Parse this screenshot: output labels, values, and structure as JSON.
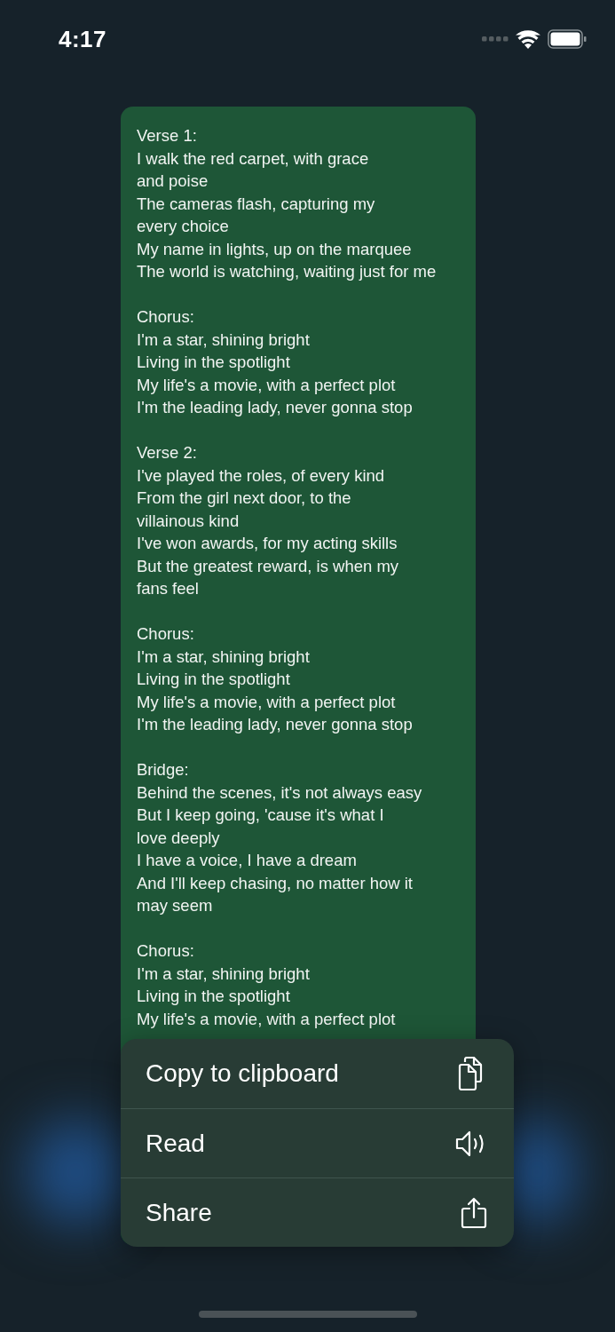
{
  "status_bar": {
    "time": "4:17"
  },
  "message": {
    "stanzas": [
      {
        "lines": [
          "Verse 1:",
          "I walk the red carpet, with grace",
          "and poise",
          "The cameras flash, capturing my",
          "every choice",
          "My name in lights, up on the marquee",
          "The world is watching, waiting just for me"
        ]
      },
      {
        "lines": [
          "Chorus:",
          "I'm a star, shining bright",
          "Living in the spotlight",
          "My life's a movie, with a perfect plot",
          "I'm the leading lady, never gonna stop"
        ]
      },
      {
        "lines": [
          "Verse 2:",
          "I've played the roles, of every kind",
          "From the girl next door, to the",
          "villainous kind",
          "I've won awards, for my acting skills",
          "But the greatest reward, is when my",
          "fans feel"
        ]
      },
      {
        "lines": [
          "Chorus:",
          "I'm a star, shining bright",
          "Living in the spotlight",
          "My life's a movie, with a perfect plot",
          "I'm the leading lady, never gonna stop"
        ]
      },
      {
        "lines": [
          "Bridge:",
          "Behind the scenes, it's not always easy",
          "But I keep going, 'cause it's what I",
          "love deeply",
          "I have a voice, I have a dream",
          "And I'll keep chasing, no matter how it",
          "may seem"
        ]
      },
      {
        "lines": [
          "Chorus:",
          "I'm a star, shining bright",
          "Living in the spotlight",
          "My life's a movie, with a perfect plot"
        ]
      }
    ]
  },
  "context_menu": [
    {
      "label": "Copy to clipboard",
      "kind": "copy"
    },
    {
      "label": "Read",
      "kind": "speak"
    },
    {
      "label": "Share",
      "kind": "share"
    }
  ]
}
